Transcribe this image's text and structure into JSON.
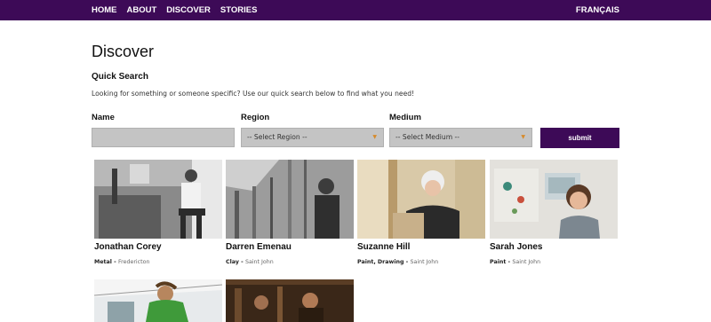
{
  "nav": {
    "items": [
      "HOME",
      "ABOUT",
      "DISCOVER",
      "STORIES"
    ],
    "language": "FRANÇAIS"
  },
  "page": {
    "title": "Discover",
    "subtitle": "Quick Search",
    "intro": "Looking for something or someone specific? Use our quick search below to find what you need!"
  },
  "search": {
    "name_label": "Name",
    "name_value": "",
    "region_label": "Region",
    "region_selected": "-- Select Region --",
    "medium_label": "Medium",
    "medium_selected": "-- Select Medium --",
    "submit_label": "submit"
  },
  "artists": [
    {
      "name": "Jonathan Corey",
      "medium": "Metal",
      "location": "Fredericton"
    },
    {
      "name": "Darren Emenau",
      "medium": "Clay",
      "location": "Saint John"
    },
    {
      "name": "Suzanne Hill",
      "medium": "Paint, Drawing",
      "location": "Saint John"
    },
    {
      "name": "Sarah Jones",
      "medium": "Paint",
      "location": "Saint John"
    },
    {
      "name": "",
      "medium": "",
      "location": ""
    },
    {
      "name": "",
      "medium": "",
      "location": ""
    }
  ],
  "colors": {
    "brand": "#3d0a57",
    "field": "#c4c4c4",
    "caret": "#d78a2a"
  }
}
